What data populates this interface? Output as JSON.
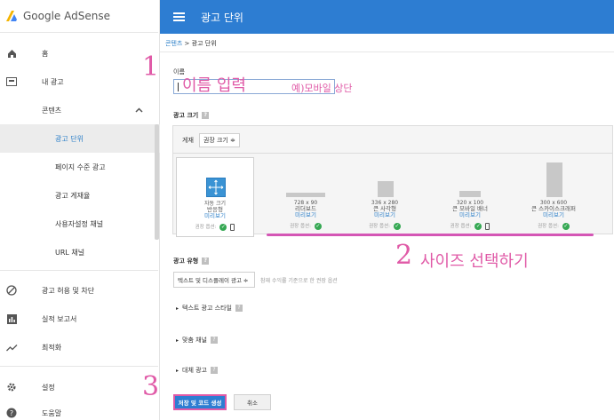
{
  "sidebar": {
    "brand": "Google AdSense",
    "items": [
      {
        "label": "홈",
        "icon": "home-icon"
      },
      {
        "label": "내 광고",
        "icon": "ads-icon"
      },
      {
        "label": "콘텐츠",
        "icon": "",
        "chevron": "^"
      },
      {
        "label": "광고 단위"
      },
      {
        "label": "페이지 수준 광고"
      },
      {
        "label": "광고 게재율"
      },
      {
        "label": "사용자설정 채널"
      },
      {
        "label": "URL 채널"
      },
      {
        "label": "광고 허용 및 차단",
        "icon": "block-icon"
      },
      {
        "label": "실적 보고서",
        "icon": "report-icon"
      },
      {
        "label": "최적화",
        "icon": "trend-icon"
      },
      {
        "label": "설정",
        "icon": "gear-icon"
      },
      {
        "label": "도움말",
        "icon": "help-icon"
      }
    ]
  },
  "header": {
    "title": "광고 단위"
  },
  "breadcrumb": {
    "link": "콘텐츠",
    "sep": " > ",
    "current": "광고 단위"
  },
  "form": {
    "name_label": "이름",
    "size_label": "광고 크기",
    "filter_label": "게재",
    "filter_value": "권장 크기 ≑",
    "type_label": "광고 유형",
    "type_value": "텍스트 및 디스플레이 광고 ≑",
    "type_hint": "참재 수익률 기준으로 한 권장 옵션",
    "collapsibles": [
      "텍스트 광고 스타일",
      "맞춤 채널",
      "대체 광고"
    ],
    "save_label": "저장 및 코드 생성",
    "cancel_label": "취소"
  },
  "ad_sizes": [
    {
      "dim": "자동 크기",
      "name": "반응형",
      "preview": "미리보기",
      "opt": "권장 옵션:"
    },
    {
      "dim": "728 x 90",
      "name": "리더보드",
      "preview": "미리보기",
      "opt": "권장 옵션:"
    },
    {
      "dim": "336 x 280",
      "name": "큰 사각형",
      "preview": "미리보기",
      "opt": "권장 옵션:"
    },
    {
      "dim": "320 x 100",
      "name": "큰 모바일 배너",
      "preview": "미리보기",
      "opt": "권장 옵션:"
    },
    {
      "dim": "300 x 600",
      "name": "큰 스카이스크래퍼",
      "preview": "미리보기",
      "opt": "권장 옵션:"
    }
  ],
  "annotations": {
    "n1": "1",
    "t1": "이름 입력",
    "t1b": "예)모바일 상단",
    "n2": "2",
    "t2": "사이즈 선택하기",
    "n3": "3"
  },
  "colors": {
    "accent": "#2d7dd2",
    "annotation": "#e05aa7",
    "check": "#35a853"
  }
}
